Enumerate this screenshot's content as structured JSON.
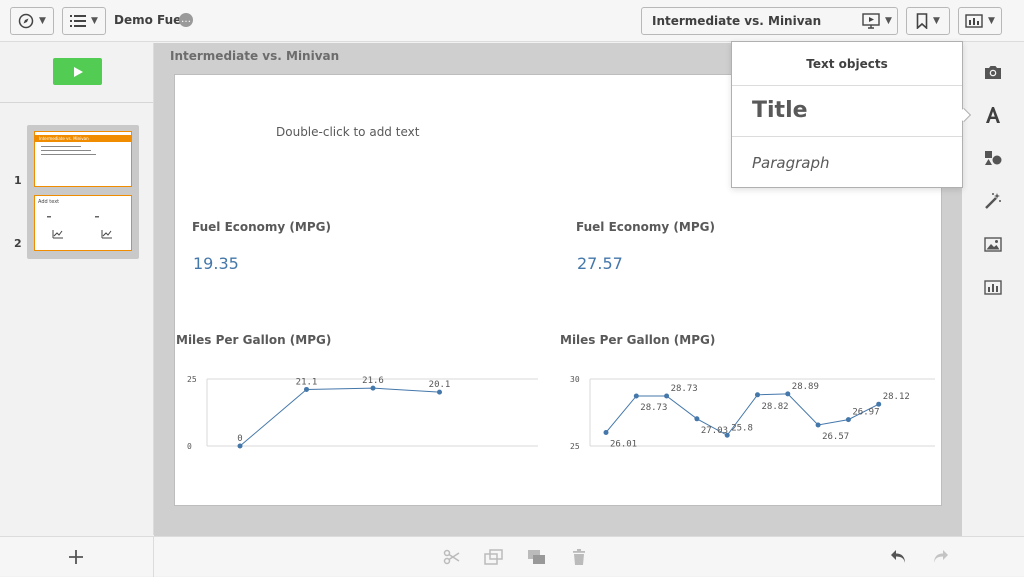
{
  "toolbar": {
    "app_name": "Demo Fuel",
    "story_name": "Intermediate vs. Minivan"
  },
  "story": {
    "heading": "Intermediate vs. Minivan",
    "slides": [
      {
        "number": "1",
        "thumb_title": "Intermediate vs. Minivan"
      },
      {
        "number": "2",
        "thumb_title": "Add text"
      }
    ]
  },
  "slide": {
    "placeholder": "Double-click to add text",
    "kpis": [
      {
        "title": "Fuel Economy (MPG)",
        "value": "19.35"
      },
      {
        "title": "Fuel Economy (MPG)",
        "value": "27.57"
      }
    ],
    "charts_titles": [
      "Miles Per Gallon (MPG)",
      "Miles Per Gallon (MPG)"
    ]
  },
  "popover": {
    "header": "Text objects",
    "title_item": "Title",
    "paragraph_item": "Paragraph"
  },
  "chart_data": [
    {
      "type": "line",
      "title": "Miles Per Gallon (MPG)",
      "values": [
        0,
        21.1,
        21.6,
        20.1
      ],
      "labels": [
        "0",
        "21.1",
        "21.6",
        "20.1"
      ],
      "ylim": [
        0,
        25
      ],
      "yticks": [
        "0",
        "25"
      ],
      "color": "#4477aa"
    },
    {
      "type": "line",
      "title": "Miles Per Gallon (MPG)",
      "values": [
        26.01,
        28.73,
        28.73,
        27.03,
        25.8,
        28.82,
        28.89,
        26.57,
        26.97,
        28.12
      ],
      "labels": [
        "26.01",
        "28.73",
        "28.73",
        "27.03",
        "25.8",
        "28.82",
        "28.89",
        "26.57",
        "26.97",
        "28.12"
      ],
      "ylim": [
        25,
        30
      ],
      "yticks": [
        "25",
        "30"
      ],
      "color": "#4477aa"
    }
  ]
}
